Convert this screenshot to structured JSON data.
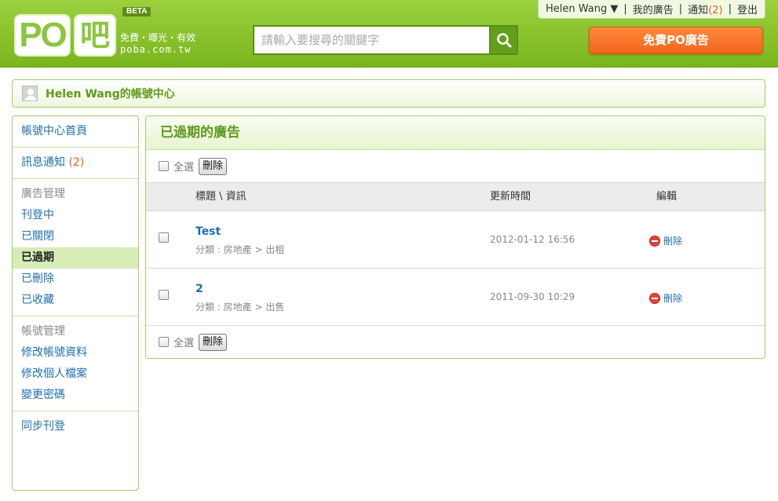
{
  "header": {
    "logo_po": "PO",
    "logo_ba": "吧",
    "beta": "BETA",
    "tagline": "免費・曝光・有效",
    "domain": "poba.com.tw",
    "search_placeholder": "請輸入要搜尋的關鍵字",
    "post_button": "免費PO廣告"
  },
  "userbar": {
    "username": "Helen Wang",
    "dropdown_arrow": "▼",
    "my_ads": "我的廣告",
    "notify": "通知",
    "notify_count": "(2)",
    "logout": "登出"
  },
  "account": {
    "title": "Helen Wang的帳號中心"
  },
  "sidebar": {
    "home": "帳號中心首頁",
    "notifications": "訊息通知",
    "notifications_count": "(2)",
    "ad_manage_head": "廣告管理",
    "ads_live": "刊登中",
    "ads_closed": "已關閉",
    "ads_expired": "已過期",
    "ads_deleted": "已刪除",
    "ads_saved": "已收藏",
    "account_manage_head": "帳號管理",
    "edit_account": "修改帳號資料",
    "edit_profile": "修改個人檔案",
    "change_password": "變更密碼",
    "sync_post": "同步刊登"
  },
  "main": {
    "title": "已過期的廣告",
    "select_all": "全選",
    "delete": "刪除",
    "columns": {
      "title": "標題 \\ 資訊",
      "updated": "更新時間",
      "edit": "編輯"
    },
    "rows": [
      {
        "title": "Test",
        "meta": "分類 : 房地產 > 出租",
        "updated": "2012-01-12 16:56",
        "action": "刪除"
      },
      {
        "title": "2",
        "meta": "分類 : 房地產 > 出售",
        "updated": "2011-09-30 10:29",
        "action": "刪除"
      }
    ]
  },
  "colors": {
    "header_green": "#8cc63f",
    "accent_orange": "#f2641a",
    "link_blue": "#1f6fad",
    "title_green": "#5f9a1c"
  }
}
